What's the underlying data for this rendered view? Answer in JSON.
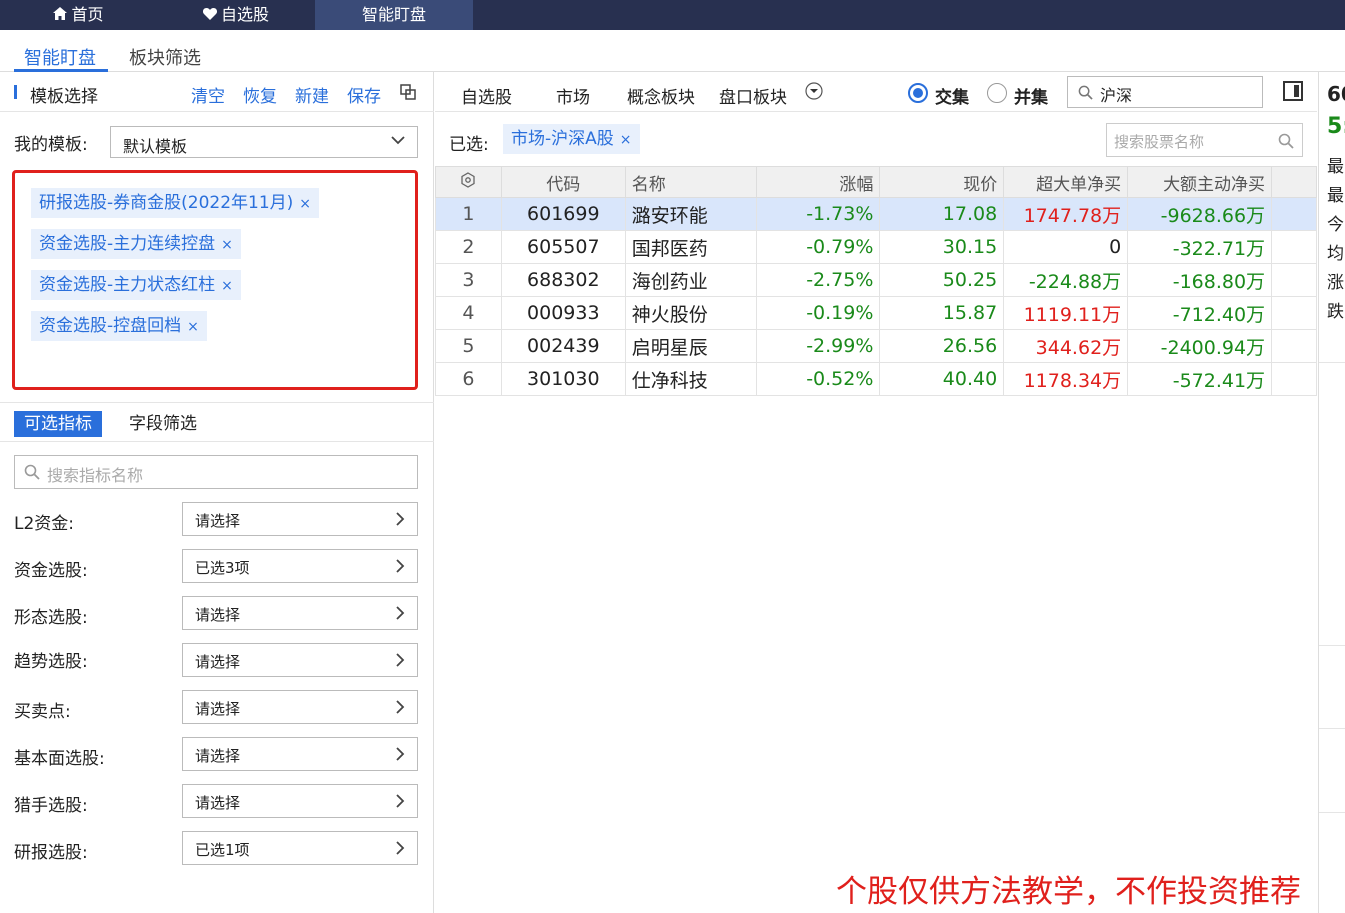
{
  "top_tabs": [
    {
      "label": "首页",
      "icon": "home-icon"
    },
    {
      "label": "自选股",
      "icon": "heart-icon"
    },
    {
      "label": "智能盯盘",
      "icon": ""
    }
  ],
  "sub_tabs": [
    "智能盯盘",
    "板块筛选"
  ],
  "template_panel": {
    "title": "模板选择",
    "actions": [
      "清空",
      "恢复",
      "新建",
      "保存"
    ],
    "my_template_label": "我的模板:",
    "my_template_value": "默认模板",
    "tags": [
      "研报选股-券商金股(2022年11月)",
      "资金选股-主力连续控盘",
      "资金选股-主力状态红柱",
      "资金选股-控盘回档"
    ],
    "tag_remove": "×"
  },
  "indicator_panel": {
    "tabs": [
      "可选指标",
      "字段筛选"
    ],
    "search_placeholder": "搜索指标名称",
    "filters": [
      {
        "label": "L2资金:",
        "value": "请选择"
      },
      {
        "label": "资金选股:",
        "value": "已选3项"
      },
      {
        "label": "形态选股:",
        "value": "请选择"
      },
      {
        "label": "趋势选股:",
        "value": "请选择"
      },
      {
        "label": "买卖点:",
        "value": "请选择"
      },
      {
        "label": "基本面选股:",
        "value": "请选择"
      },
      {
        "label": "猎手选股:",
        "value": "请选择"
      },
      {
        "label": "研报选股:",
        "value": "已选1项"
      }
    ]
  },
  "market_bar": {
    "tabs": [
      "自选股",
      "市场",
      "概念板块",
      "盘口板块"
    ],
    "radio_intersect": "交集",
    "radio_union": "并集",
    "market_value": "沪深",
    "selected_label": "已选:",
    "selected_tag": "市场-沪深A股",
    "stock_search_placeholder": "搜索股票名称"
  },
  "table": {
    "headers": [
      "代码",
      "名称",
      "涨幅",
      "现价",
      "超大单净买",
      "大额主动净买"
    ],
    "rows": [
      {
        "idx": "1",
        "code": "601699",
        "name": "潞安环能",
        "chg": "-1.73%",
        "price": "17.08",
        "super": "1747.78万",
        "super_color": "red",
        "big": "-9628.66万"
      },
      {
        "idx": "2",
        "code": "605507",
        "name": "国邦医药",
        "chg": "-0.79%",
        "price": "30.15",
        "super": "0",
        "super_color": "black",
        "big": "-322.71万"
      },
      {
        "idx": "3",
        "code": "688302",
        "name": "海创药业",
        "chg": "-2.75%",
        "price": "50.25",
        "super": "-224.88万",
        "super_color": "green",
        "big": "-168.80万"
      },
      {
        "idx": "4",
        "code": "000933",
        "name": "神火股份",
        "chg": "-0.19%",
        "price": "15.87",
        "super": "1119.11万",
        "super_color": "red",
        "big": "-712.40万"
      },
      {
        "idx": "5",
        "code": "002439",
        "name": "启明星辰",
        "chg": "-2.99%",
        "price": "26.56",
        "super": "344.62万",
        "super_color": "red",
        "big": "-2400.94万"
      },
      {
        "idx": "6",
        "code": "301030",
        "name": "仕净科技",
        "chg": "-0.52%",
        "price": "40.40",
        "super": "1178.34万",
        "super_color": "red",
        "big": "-572.41万"
      }
    ]
  },
  "right_panel": {
    "code": "60",
    "price": "5:",
    "rows": [
      "最",
      "最",
      "今",
      "均",
      "涨",
      "跌"
    ]
  },
  "disclaimer": "个股仅供方法教学，不作投资推荐",
  "colors": {
    "accent": "#2a6fdb",
    "topbar": "#283050",
    "up": "#e0201c",
    "down": "#1a8a1a"
  }
}
